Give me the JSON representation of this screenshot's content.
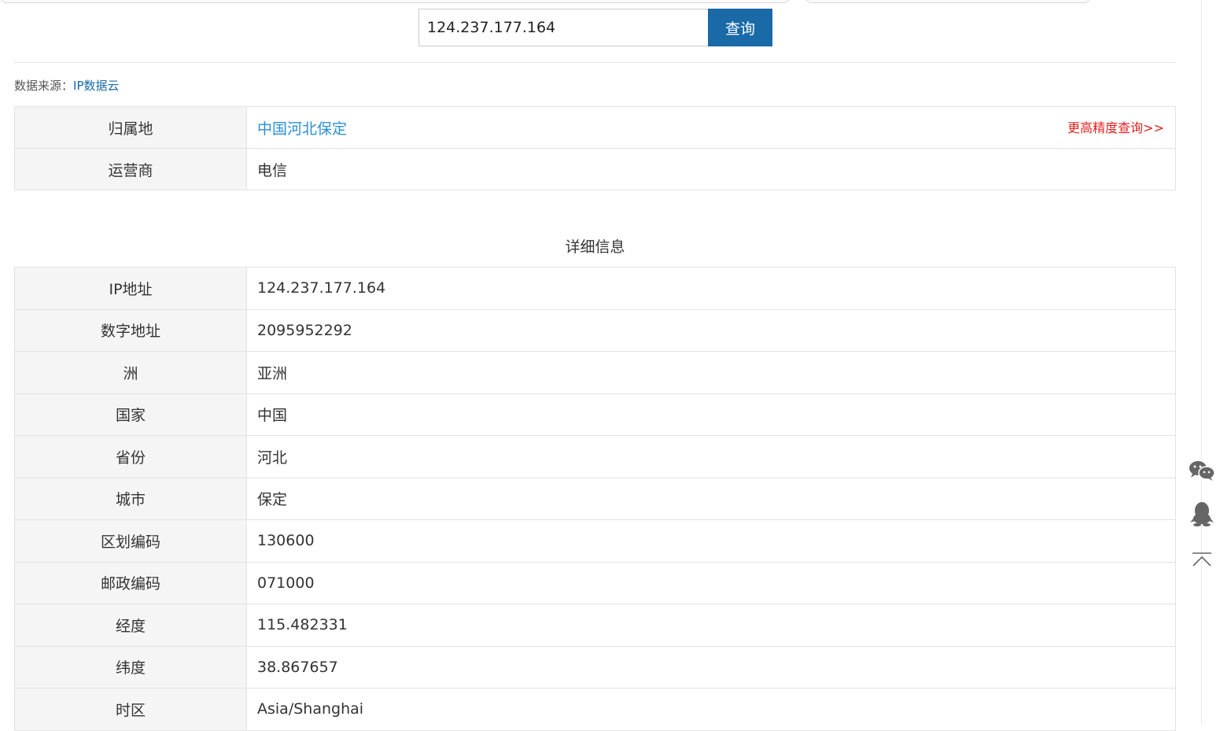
{
  "search": {
    "query": "124.237.177.164",
    "button_label": "查询"
  },
  "source": {
    "label": "数据来源：",
    "link_text": "IP数据云"
  },
  "summary": {
    "rows": [
      {
        "key": "归属地",
        "value": "中国河北保定",
        "action": "更高精度查询>>"
      },
      {
        "key": "运营商",
        "value": "电信"
      }
    ]
  },
  "details": {
    "title": "详细信息",
    "rows": [
      {
        "key": "IP地址",
        "value": "124.237.177.164"
      },
      {
        "key": "数字地址",
        "value": "2095952292"
      },
      {
        "key": "洲",
        "value": "亚洲"
      },
      {
        "key": "国家",
        "value": "中国"
      },
      {
        "key": "省份",
        "value": "河北"
      },
      {
        "key": "城市",
        "value": "保定"
      },
      {
        "key": "区划编码",
        "value": "130600"
      },
      {
        "key": "邮政编码",
        "value": "071000"
      },
      {
        "key": "经度",
        "value": "115.482331"
      },
      {
        "key": "纬度",
        "value": "38.867657"
      },
      {
        "key": "时区",
        "value": "Asia/Shanghai"
      }
    ]
  },
  "side_toolbar": {
    "icons": [
      "wechat-icon",
      "qq-icon",
      "back-to-top-icon"
    ]
  },
  "colors": {
    "primary": "#1a6aa8",
    "link": "#2a8fd6",
    "alert": "#e02020",
    "key_cell_bg": "#f5f5f5"
  }
}
